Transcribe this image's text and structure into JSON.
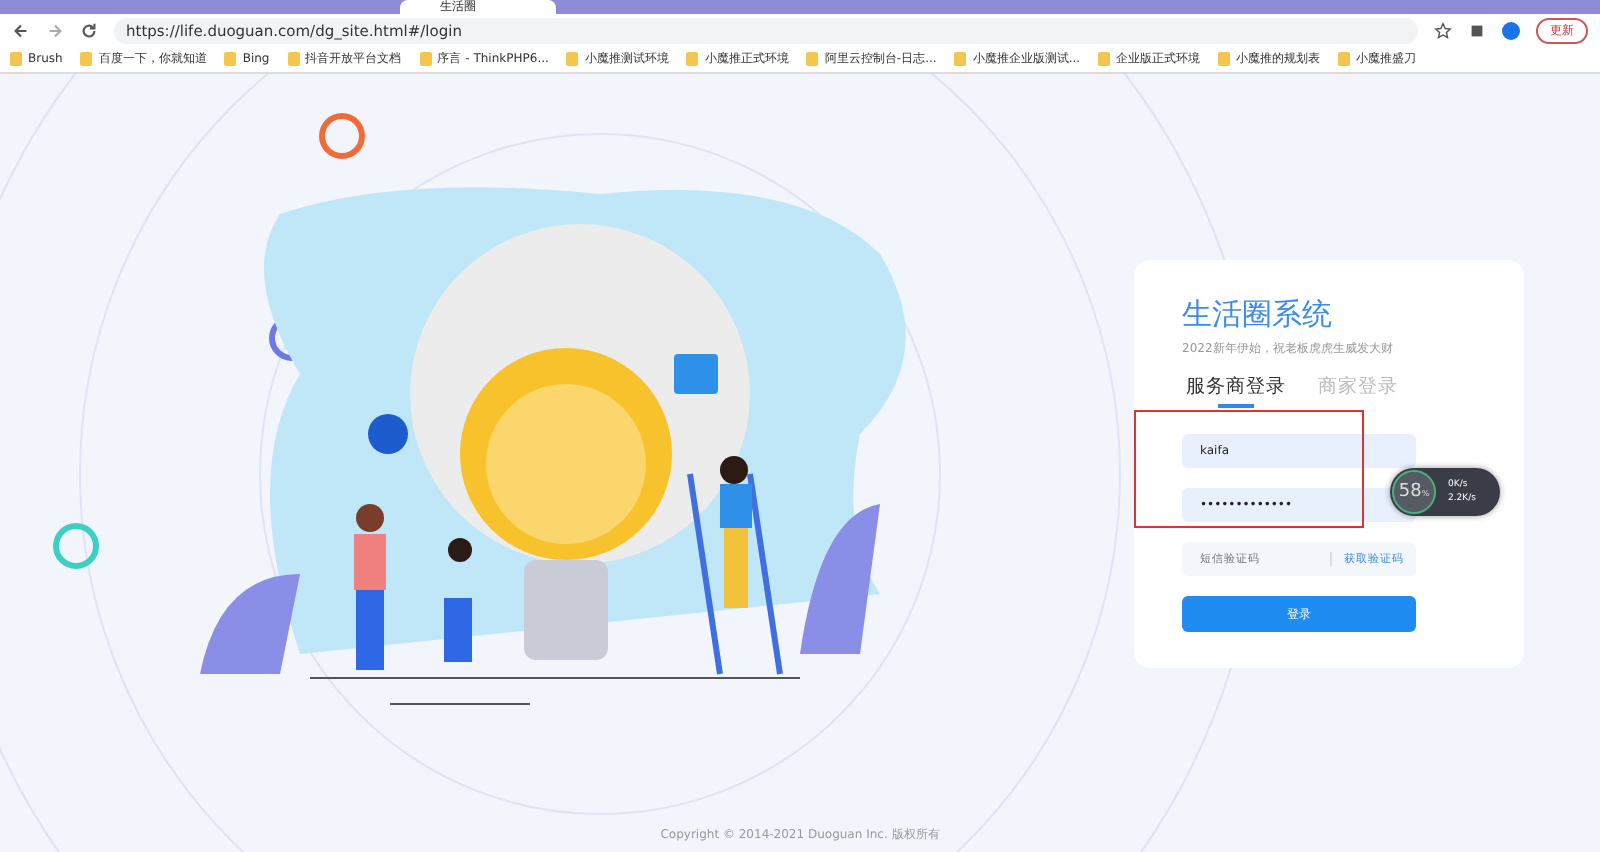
{
  "browser": {
    "tabs": [
      {
        "title": "生活圈",
        "selected": true
      }
    ],
    "address": "https://life.duoguan.com/dg_site.html#/login",
    "update_button": "更新",
    "bookmarks": [
      {
        "label": "Brush"
      },
      {
        "label": "百度一下，你就知道"
      },
      {
        "label": "Bing"
      },
      {
        "label": "抖音开放平台文档"
      },
      {
        "label": "序言 - ThinkPHP6..."
      },
      {
        "label": "小魔推测试环境"
      },
      {
        "label": "小魔推正式环境"
      },
      {
        "label": "阿里云控制台-日志..."
      },
      {
        "label": "小魔推企业版测试..."
      },
      {
        "label": "企业版正式环境"
      },
      {
        "label": "小魔推的规划表"
      },
      {
        "label": "小魔推盛刀"
      }
    ]
  },
  "login": {
    "title": "生活圈系统",
    "subtitle": "2022新年伊始，祝老板虎虎生威发大财",
    "tabs": [
      {
        "label": "服务商登录",
        "selected": true
      },
      {
        "label": "商家登录",
        "selected": false
      }
    ],
    "username": "kaifa",
    "password": "•••••••••••••",
    "sms_placeholder": "短信验证码",
    "sms_button": "获取验证码",
    "submit": "登录"
  },
  "net_widget": {
    "percent": "58",
    "unit": "%",
    "upload": "0K/s",
    "download": "2.2K/s"
  },
  "footer": "Copyright © 2014-2021 Duoguan Inc. 版权所有"
}
